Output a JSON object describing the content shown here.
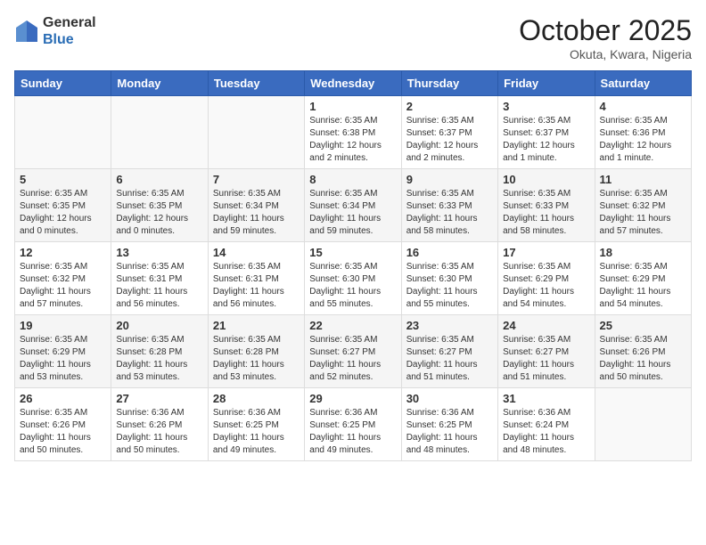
{
  "header": {
    "logo_line1": "General",
    "logo_line2": "Blue",
    "month": "October 2025",
    "location": "Okuta, Kwara, Nigeria"
  },
  "days_of_week": [
    "Sunday",
    "Monday",
    "Tuesday",
    "Wednesday",
    "Thursday",
    "Friday",
    "Saturday"
  ],
  "weeks": [
    [
      {
        "day": "",
        "info": ""
      },
      {
        "day": "",
        "info": ""
      },
      {
        "day": "",
        "info": ""
      },
      {
        "day": "1",
        "info": "Sunrise: 6:35 AM\nSunset: 6:38 PM\nDaylight: 12 hours\nand 2 minutes."
      },
      {
        "day": "2",
        "info": "Sunrise: 6:35 AM\nSunset: 6:37 PM\nDaylight: 12 hours\nand 2 minutes."
      },
      {
        "day": "3",
        "info": "Sunrise: 6:35 AM\nSunset: 6:37 PM\nDaylight: 12 hours\nand 1 minute."
      },
      {
        "day": "4",
        "info": "Sunrise: 6:35 AM\nSunset: 6:36 PM\nDaylight: 12 hours\nand 1 minute."
      }
    ],
    [
      {
        "day": "5",
        "info": "Sunrise: 6:35 AM\nSunset: 6:35 PM\nDaylight: 12 hours\nand 0 minutes."
      },
      {
        "day": "6",
        "info": "Sunrise: 6:35 AM\nSunset: 6:35 PM\nDaylight: 12 hours\nand 0 minutes."
      },
      {
        "day": "7",
        "info": "Sunrise: 6:35 AM\nSunset: 6:34 PM\nDaylight: 11 hours\nand 59 minutes."
      },
      {
        "day": "8",
        "info": "Sunrise: 6:35 AM\nSunset: 6:34 PM\nDaylight: 11 hours\nand 59 minutes."
      },
      {
        "day": "9",
        "info": "Sunrise: 6:35 AM\nSunset: 6:33 PM\nDaylight: 11 hours\nand 58 minutes."
      },
      {
        "day": "10",
        "info": "Sunrise: 6:35 AM\nSunset: 6:33 PM\nDaylight: 11 hours\nand 58 minutes."
      },
      {
        "day": "11",
        "info": "Sunrise: 6:35 AM\nSunset: 6:32 PM\nDaylight: 11 hours\nand 57 minutes."
      }
    ],
    [
      {
        "day": "12",
        "info": "Sunrise: 6:35 AM\nSunset: 6:32 PM\nDaylight: 11 hours\nand 57 minutes."
      },
      {
        "day": "13",
        "info": "Sunrise: 6:35 AM\nSunset: 6:31 PM\nDaylight: 11 hours\nand 56 minutes."
      },
      {
        "day": "14",
        "info": "Sunrise: 6:35 AM\nSunset: 6:31 PM\nDaylight: 11 hours\nand 56 minutes."
      },
      {
        "day": "15",
        "info": "Sunrise: 6:35 AM\nSunset: 6:30 PM\nDaylight: 11 hours\nand 55 minutes."
      },
      {
        "day": "16",
        "info": "Sunrise: 6:35 AM\nSunset: 6:30 PM\nDaylight: 11 hours\nand 55 minutes."
      },
      {
        "day": "17",
        "info": "Sunrise: 6:35 AM\nSunset: 6:29 PM\nDaylight: 11 hours\nand 54 minutes."
      },
      {
        "day": "18",
        "info": "Sunrise: 6:35 AM\nSunset: 6:29 PM\nDaylight: 11 hours\nand 54 minutes."
      }
    ],
    [
      {
        "day": "19",
        "info": "Sunrise: 6:35 AM\nSunset: 6:29 PM\nDaylight: 11 hours\nand 53 minutes."
      },
      {
        "day": "20",
        "info": "Sunrise: 6:35 AM\nSunset: 6:28 PM\nDaylight: 11 hours\nand 53 minutes."
      },
      {
        "day": "21",
        "info": "Sunrise: 6:35 AM\nSunset: 6:28 PM\nDaylight: 11 hours\nand 53 minutes."
      },
      {
        "day": "22",
        "info": "Sunrise: 6:35 AM\nSunset: 6:27 PM\nDaylight: 11 hours\nand 52 minutes."
      },
      {
        "day": "23",
        "info": "Sunrise: 6:35 AM\nSunset: 6:27 PM\nDaylight: 11 hours\nand 51 minutes."
      },
      {
        "day": "24",
        "info": "Sunrise: 6:35 AM\nSunset: 6:27 PM\nDaylight: 11 hours\nand 51 minutes."
      },
      {
        "day": "25",
        "info": "Sunrise: 6:35 AM\nSunset: 6:26 PM\nDaylight: 11 hours\nand 50 minutes."
      }
    ],
    [
      {
        "day": "26",
        "info": "Sunrise: 6:35 AM\nSunset: 6:26 PM\nDaylight: 11 hours\nand 50 minutes."
      },
      {
        "day": "27",
        "info": "Sunrise: 6:36 AM\nSunset: 6:26 PM\nDaylight: 11 hours\nand 50 minutes."
      },
      {
        "day": "28",
        "info": "Sunrise: 6:36 AM\nSunset: 6:25 PM\nDaylight: 11 hours\nand 49 minutes."
      },
      {
        "day": "29",
        "info": "Sunrise: 6:36 AM\nSunset: 6:25 PM\nDaylight: 11 hours\nand 49 minutes."
      },
      {
        "day": "30",
        "info": "Sunrise: 6:36 AM\nSunset: 6:25 PM\nDaylight: 11 hours\nand 48 minutes."
      },
      {
        "day": "31",
        "info": "Sunrise: 6:36 AM\nSunset: 6:24 PM\nDaylight: 11 hours\nand 48 minutes."
      },
      {
        "day": "",
        "info": ""
      }
    ]
  ]
}
